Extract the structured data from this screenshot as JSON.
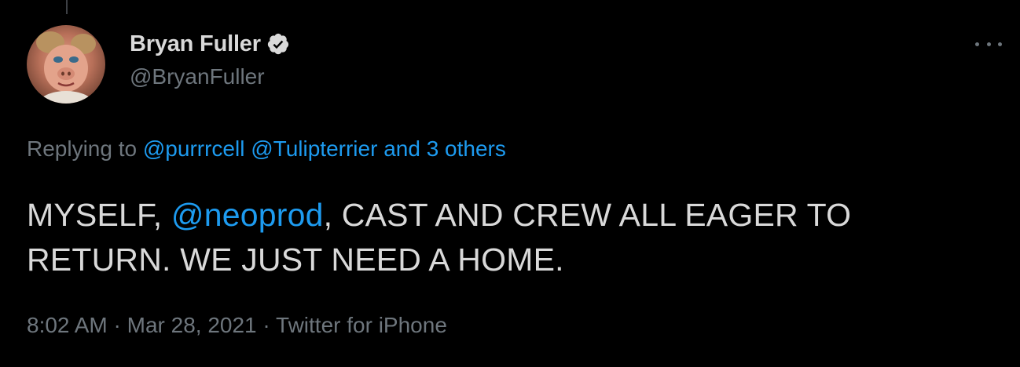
{
  "tweet": {
    "author": {
      "display_name": "Bryan Fuller",
      "handle": "@BryanFuller",
      "verified": true,
      "avatar_icon": "avatar-photo"
    },
    "more_icon": "more-options-icon",
    "replying": {
      "prefix": "Replying to ",
      "users": [
        "@purrrcell",
        "@Tulipterrier"
      ],
      "others": "and 3 others"
    },
    "text": {
      "part1": "MYSELF, ",
      "mention": "@neoprod",
      "part2": ", CAST AND CREW ALL EAGER TO RETURN. WE JUST NEED A HOME."
    },
    "meta": {
      "time": "8:02 AM",
      "separator": " · ",
      "date": "Mar 28, 2021",
      "source": "Twitter for iPhone"
    }
  },
  "colors": {
    "background": "#000000",
    "text": "#d9d9d9",
    "secondary": "#6e767d",
    "link": "#1d9bf0",
    "verified_badge": "#d9d9d9"
  }
}
